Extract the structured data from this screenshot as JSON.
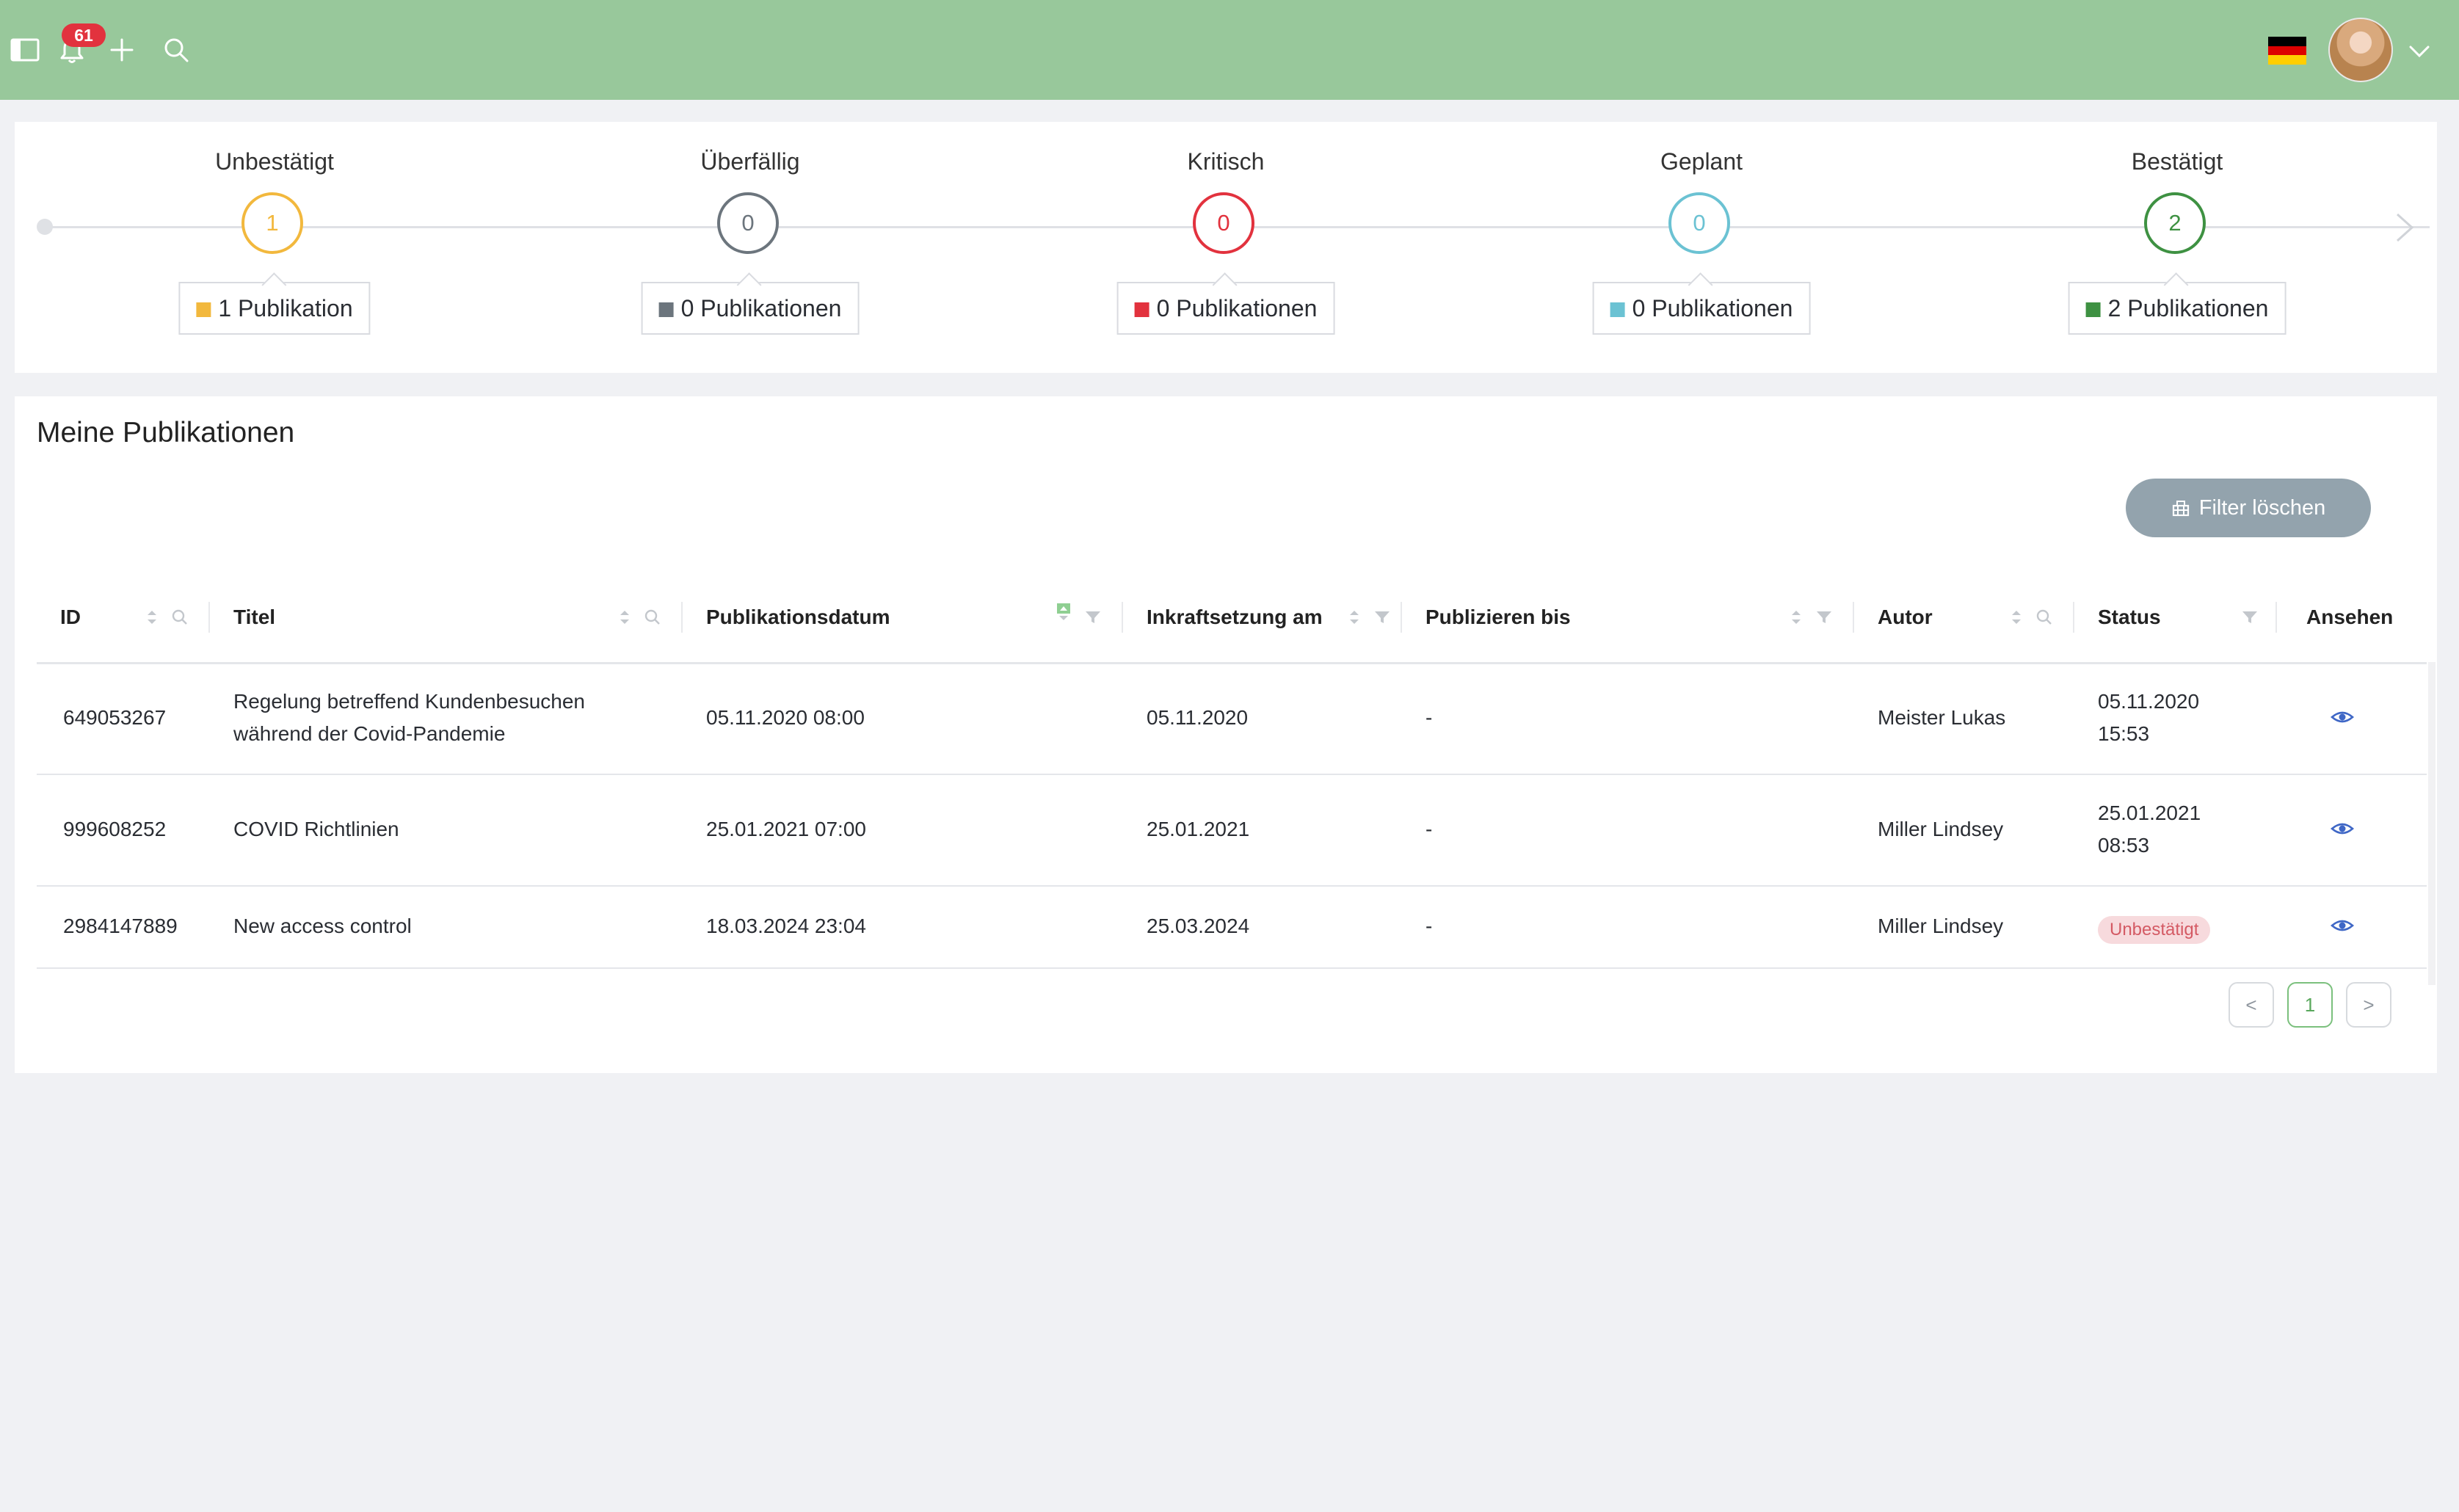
{
  "topbar": {
    "notifications_count": "61",
    "icons": [
      "sidebar-toggle-icon",
      "bell-icon",
      "plus-icon",
      "search-icon",
      "flag-de-icon",
      "chevron-down-icon"
    ],
    "colors": {
      "background": "#98c89b",
      "badge": "#e2323e"
    }
  },
  "status_overview": {
    "stages": [
      {
        "label": "Unbestätigt",
        "count": "1",
        "publications": "1 Publikation",
        "color": "#f2b83d"
      },
      {
        "label": "Überfällig",
        "count": "0",
        "publications": "0 Publikationen",
        "color": "#6c757d"
      },
      {
        "label": "Kritisch",
        "count": "0",
        "publications": "0 Publikationen",
        "color": "#e2323e"
      },
      {
        "label": "Geplant",
        "count": "0",
        "publications": "0 Publikationen",
        "color": "#6bc2d3"
      },
      {
        "label": "Bestätigt",
        "count": "2",
        "publications": "2 Publikationen",
        "color": "#3e9142"
      }
    ]
  },
  "publications": {
    "title": "Meine Publikationen",
    "filter_button": "Filter löschen",
    "columns": {
      "id": "ID",
      "title": "Titel",
      "pub_date": "Publikationsdatum",
      "effective": "Inkraftsetzung am",
      "until": "Publizieren bis",
      "author": "Autor",
      "status": "Status",
      "view": "Ansehen"
    },
    "rows": [
      {
        "id": "649053267",
        "title_line1": "Regelung betreffend Kundenbesuchen",
        "title_line2": "während der Covid-Pandemie",
        "pub_date": "05.11.2020 08:00",
        "effective": "05.11.2020",
        "until": "-",
        "author": "Meister Lukas",
        "status_line1": "05.11.2020",
        "status_line2": "15:53"
      },
      {
        "id": "999608252",
        "title_line1": "COVID Richtlinien",
        "title_line2": "",
        "pub_date": "25.01.2021 07:00",
        "effective": "25.01.2021",
        "until": "-",
        "author": "Miller Lindsey",
        "status_line1": "25.01.2021",
        "status_line2": "08:53"
      },
      {
        "id": "2984147889",
        "title_line1": "New access control",
        "title_line2": "",
        "pub_date": "18.03.2024 23:04",
        "effective": "25.03.2024",
        "until": "-",
        "author": "Miller Lindsey",
        "status_badge": "Unbestätigt"
      }
    ],
    "pagination": {
      "prev": "<",
      "current": "1",
      "next": ">"
    }
  }
}
